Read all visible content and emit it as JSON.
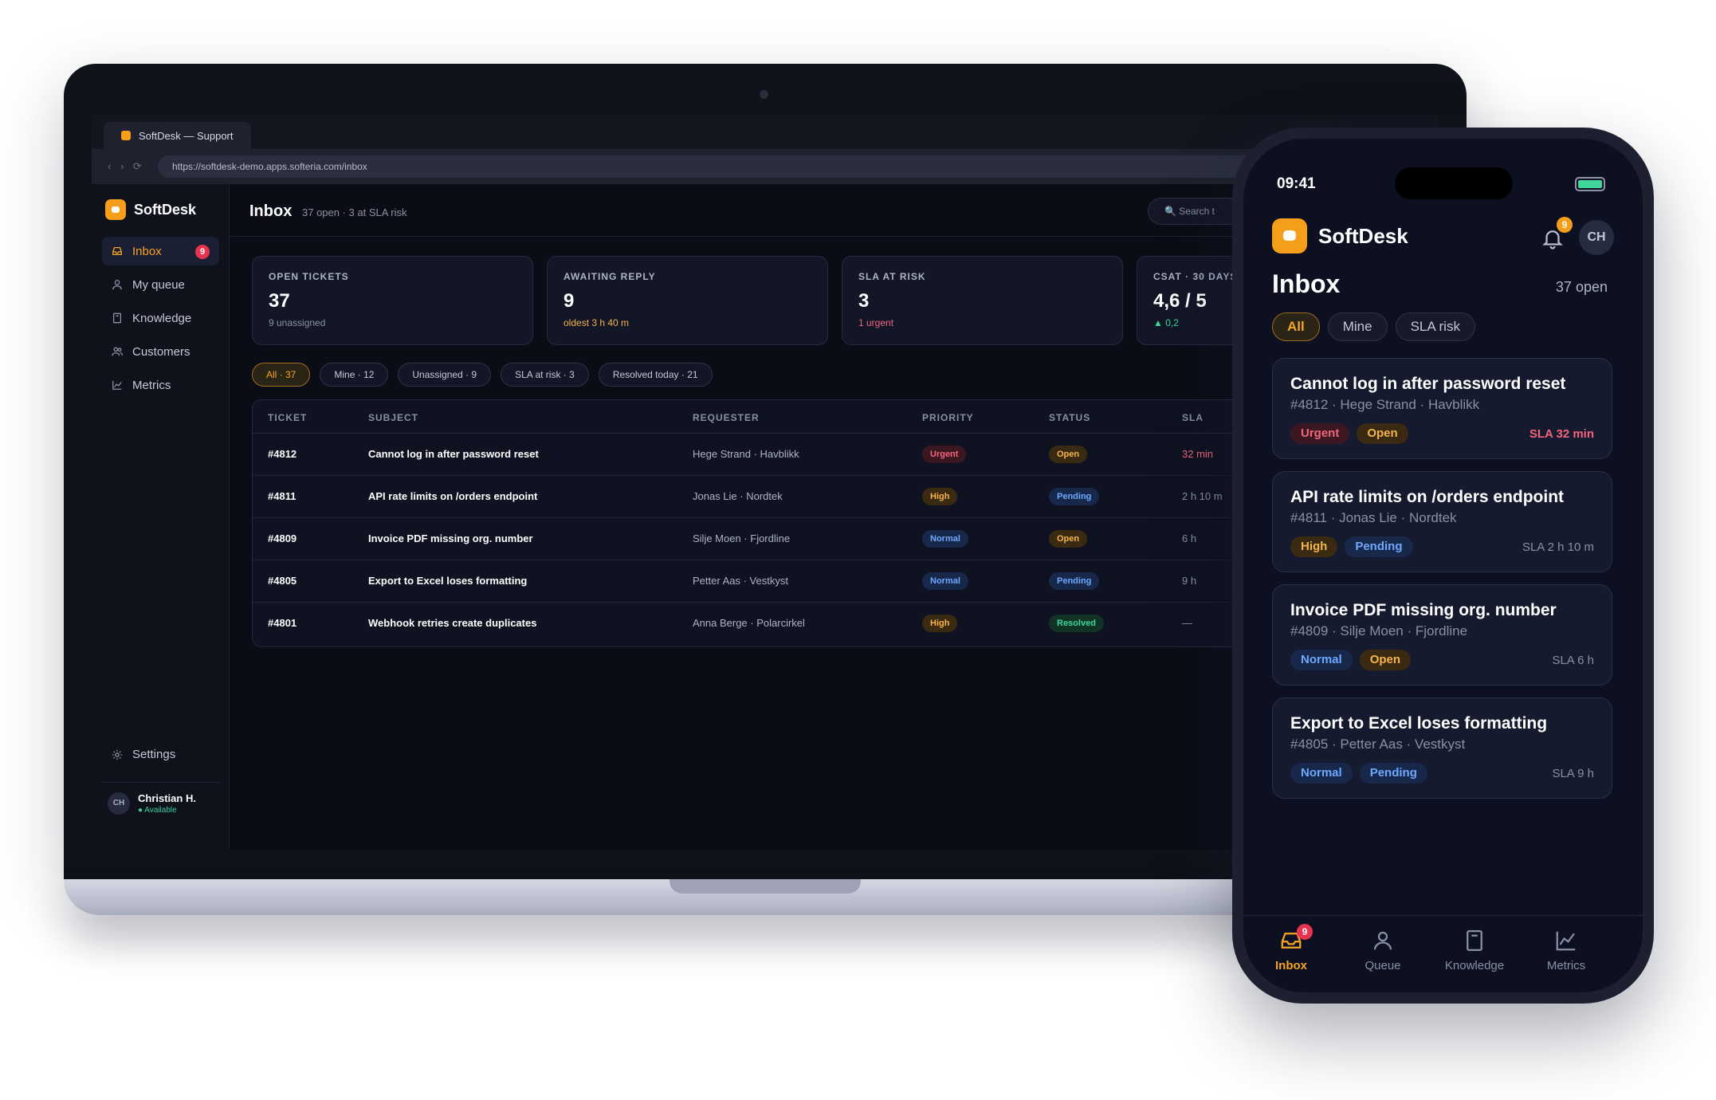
{
  "browser": {
    "tab_title": "SoftDesk — Support",
    "nav_glyphs": "‹ › ⟳",
    "url": "https://softdesk-demo.apps.softeria.com/inbox"
  },
  "brand": {
    "name": "SoftDesk",
    "color": "#f59e1c"
  },
  "sidebar": {
    "items": [
      {
        "label": "Inbox",
        "icon": "inbox-icon",
        "badge": "9"
      },
      {
        "label": "My queue",
        "icon": "user-icon"
      },
      {
        "label": "Knowledge",
        "icon": "book-icon"
      },
      {
        "label": "Customers",
        "icon": "users-icon"
      },
      {
        "label": "Metrics",
        "icon": "chart-icon"
      }
    ],
    "settings_label": "Settings",
    "user": {
      "initials": "CH",
      "name": "Christian H.",
      "status": "● Available"
    }
  },
  "header": {
    "title": "Inbox",
    "subtitle": "37 open · 3 at SLA risk",
    "search_placeholder": "🔍 Search t"
  },
  "kpis": [
    {
      "label": "OPEN TICKETS",
      "value": "37",
      "note": "9 unassigned",
      "note_color": "#8a90a3"
    },
    {
      "label": "AWAITING REPLY",
      "value": "9",
      "note": "oldest 3 h 40 m",
      "note_color": "#f5b44a"
    },
    {
      "label": "SLA AT RISK",
      "value": "3",
      "note": "1 urgent",
      "note_color": "#f0667d"
    },
    {
      "label": "CSAT · 30 DAYS",
      "value": "4,6 / 5",
      "note": "▲ 0,2",
      "note_color": "#3fd69c"
    }
  ],
  "filters": [
    "All · 37",
    "Mine · 12",
    "Unassigned · 9",
    "SLA at risk · 3",
    "Resolved today · 21"
  ],
  "table": {
    "columns": [
      "TICKET",
      "SUBJECT",
      "REQUESTER",
      "PRIORITY",
      "STATUS",
      "SLA"
    ],
    "rows": [
      {
        "id": "#4812",
        "subject": "Cannot log in after password reset",
        "requester": "Hege Strand · Havblikk",
        "priority": "Urgent",
        "status": "Open",
        "sla": "32 min",
        "sla_color": "#f0667d"
      },
      {
        "id": "#4811",
        "subject": "API rate limits on /orders endpoint",
        "requester": "Jonas Lie · Nordtek",
        "priority": "High",
        "status": "Pending",
        "sla": "2 h 10 m",
        "sla_color": "#8a90a3"
      },
      {
        "id": "#4809",
        "subject": "Invoice PDF missing org. number",
        "requester": "Silje Moen · Fjordline",
        "priority": "Normal",
        "status": "Open",
        "sla": "6 h",
        "sla_color": "#8a90a3"
      },
      {
        "id": "#4805",
        "subject": "Export to Excel loses formatting",
        "requester": "Petter Aas · Vestkyst",
        "priority": "Normal",
        "status": "Pending",
        "sla": "9 h",
        "sla_color": "#8a90a3"
      },
      {
        "id": "#4801",
        "subject": "Webhook retries create duplicates",
        "requester": "Anna Berge · Polarcirkel",
        "priority": "High",
        "status": "Resolved",
        "sla": "—",
        "sla_color": "#8a90a3"
      }
    ]
  },
  "mobile": {
    "time": "09:41",
    "notif_badge": "9",
    "avatar": "CH",
    "title": "Inbox",
    "count": "37 open",
    "filters": [
      "All",
      "Mine",
      "SLA risk"
    ],
    "cards": [
      {
        "title": "Cannot log in after password reset",
        "meta": "#4812 · Hege Strand · Havblikk",
        "priority": "Urgent",
        "status": "Open",
        "sla": "SLA 32 min",
        "urgent": true
      },
      {
        "title": "API rate limits on /orders endpoint",
        "meta": "#4811 · Jonas Lie · Nordtek",
        "priority": "High",
        "status": "Pending",
        "sla": "SLA 2 h 10 m"
      },
      {
        "title": "Invoice PDF missing org. number",
        "meta": "#4809 · Silje Moen · Fjordline",
        "priority": "Normal",
        "status": "Open",
        "sla": "SLA 6 h"
      },
      {
        "title": "Export to Excel loses formatting",
        "meta": "#4805 · Petter Aas · Vestkyst",
        "priority": "Normal",
        "status": "Pending",
        "sla": "SLA 9 h"
      }
    ],
    "tabs": [
      {
        "label": "Inbox",
        "icon": "inbox-icon",
        "badge": "9"
      },
      {
        "label": "Queue",
        "icon": "user-icon"
      },
      {
        "label": "Knowledge",
        "icon": "book-icon"
      },
      {
        "label": "Metrics",
        "icon": "chart-icon"
      }
    ]
  }
}
